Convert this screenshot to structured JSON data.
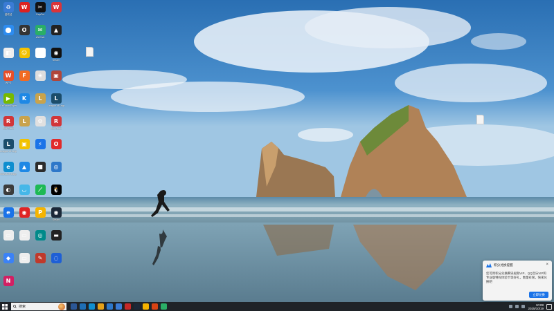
{
  "desktop_icons": [
    {
      "label": "回收站",
      "color": "#3a7bd5",
      "glyph": "♻"
    },
    {
      "label": "",
      "color": "#d22",
      "glyph": "W"
    },
    {
      "label": "CapCut",
      "color": "#111",
      "glyph": "✂"
    },
    {
      "label": "",
      "color": "#d9343a",
      "glyph": "W"
    },
    {
      "label": "",
      "color": "#2d8cf0",
      "glyph": "⬤"
    },
    {
      "label": "",
      "color": "#333",
      "glyph": "O"
    },
    {
      "label": "WeChat",
      "color": "#2aae67",
      "glyph": "✉"
    },
    {
      "label": "",
      "color": "#222",
      "glyph": "▲"
    },
    {
      "label": "",
      "color": "#eee",
      "glyph": "◧"
    },
    {
      "label": "",
      "color": "#f5c200",
      "glyph": "☺"
    },
    {
      "label": "",
      "color": "#fff",
      "glyph": "P"
    },
    {
      "label": "Steam",
      "color": "#111",
      "glyph": "◉"
    },
    {
      "label": "WPS",
      "color": "#e8502a",
      "glyph": "W"
    },
    {
      "label": "",
      "color": "#f26b22",
      "glyph": "F"
    },
    {
      "label": "",
      "color": "#ddd",
      "glyph": "❀"
    },
    {
      "label": "",
      "color": "#b1463a",
      "glyph": "▣"
    },
    {
      "label": "GeForce Experience",
      "color": "#76b900",
      "glyph": "▶"
    },
    {
      "label": "",
      "color": "#1e88e5",
      "glyph": "K"
    },
    {
      "label": "",
      "color": "#c9a34b",
      "glyph": "L"
    },
    {
      "label": "League of Legends",
      "color": "#1b4d6b",
      "glyph": "L"
    },
    {
      "label": "Riot Client",
      "color": "#d13639",
      "glyph": "R"
    },
    {
      "label": "",
      "color": "#c9a34b",
      "glyph": "L"
    },
    {
      "label": "",
      "color": "#e0e0e0",
      "glyph": "⚙"
    },
    {
      "label": "Riot Client",
      "color": "#d13639",
      "glyph": "R"
    },
    {
      "label": "League of Legends",
      "color": "#1b4d6b",
      "glyph": "L"
    },
    {
      "label": "",
      "color": "#f2c200",
      "glyph": "▣"
    },
    {
      "label": "",
      "color": "#1a73e8",
      "glyph": "⚡"
    },
    {
      "label": "",
      "color": "#e12b2b",
      "glyph": "O"
    },
    {
      "label": "Microsoft Edge",
      "color": "#0f8ecf",
      "glyph": "e"
    },
    {
      "label": "",
      "color": "#1e88e5",
      "glyph": "▲"
    },
    {
      "label": "",
      "color": "#2b2b2b",
      "glyph": "■"
    },
    {
      "label": "",
      "color": "#2d77c9",
      "glyph": "◎"
    },
    {
      "label": "",
      "color": "#3c3c3c",
      "glyph": "◐"
    },
    {
      "label": "",
      "color": "#45b7e8",
      "glyph": "◡"
    },
    {
      "label": "",
      "color": "#1db954",
      "glyph": "⟋"
    },
    {
      "label": "",
      "color": "#000",
      "glyph": "🐧"
    },
    {
      "label": "",
      "color": "#1a73e8",
      "glyph": "e"
    },
    {
      "label": "",
      "color": "#e02424",
      "glyph": "◉"
    },
    {
      "label": "",
      "color": "#f5b400",
      "glyph": "P"
    },
    {
      "label": "Steam",
      "color": "#1b2838",
      "glyph": "◉"
    },
    {
      "label": "",
      "color": "#eee",
      "glyph": "▭"
    },
    {
      "label": "",
      "color": "#eee",
      "glyph": "▭"
    },
    {
      "label": "",
      "color": "#008a8a",
      "glyph": "◎"
    },
    {
      "label": "",
      "color": "#222",
      "glyph": "▬"
    },
    {
      "label": "",
      "color": "#3b82f6",
      "glyph": "◆"
    },
    {
      "label": "",
      "color": "#eee",
      "glyph": "▭"
    },
    {
      "label": "",
      "color": "#c0392b",
      "glyph": "✎"
    },
    {
      "label": "",
      "color": "#1e5fd6",
      "glyph": "◌"
    },
    {
      "label": "",
      "color": "#d21f63",
      "glyph": "N"
    }
  ],
  "desktop_files": [
    {
      "label": ""
    },
    {
      "label": ""
    }
  ],
  "taskbar": {
    "search_text": "搜索",
    "apps": [
      "#2b5797",
      "#1f6fb5",
      "#0f8ecf",
      "#e6a118",
      "#2d77c9",
      "#3a7bd5",
      "#c62828",
      "#1b2838",
      "#f5b400",
      "#d84315",
      "#2aae67"
    ],
    "time": "10:08",
    "date": "2025/10/19"
  },
  "notification": {
    "title": "积分兑换提醒",
    "body": "您可用积分兑换腾讯视频VIP、QQ音乐VIP和专业版特权体验卡等好礼，数量有限，快来兑换吧",
    "button": "立即兑换",
    "close": "×"
  }
}
